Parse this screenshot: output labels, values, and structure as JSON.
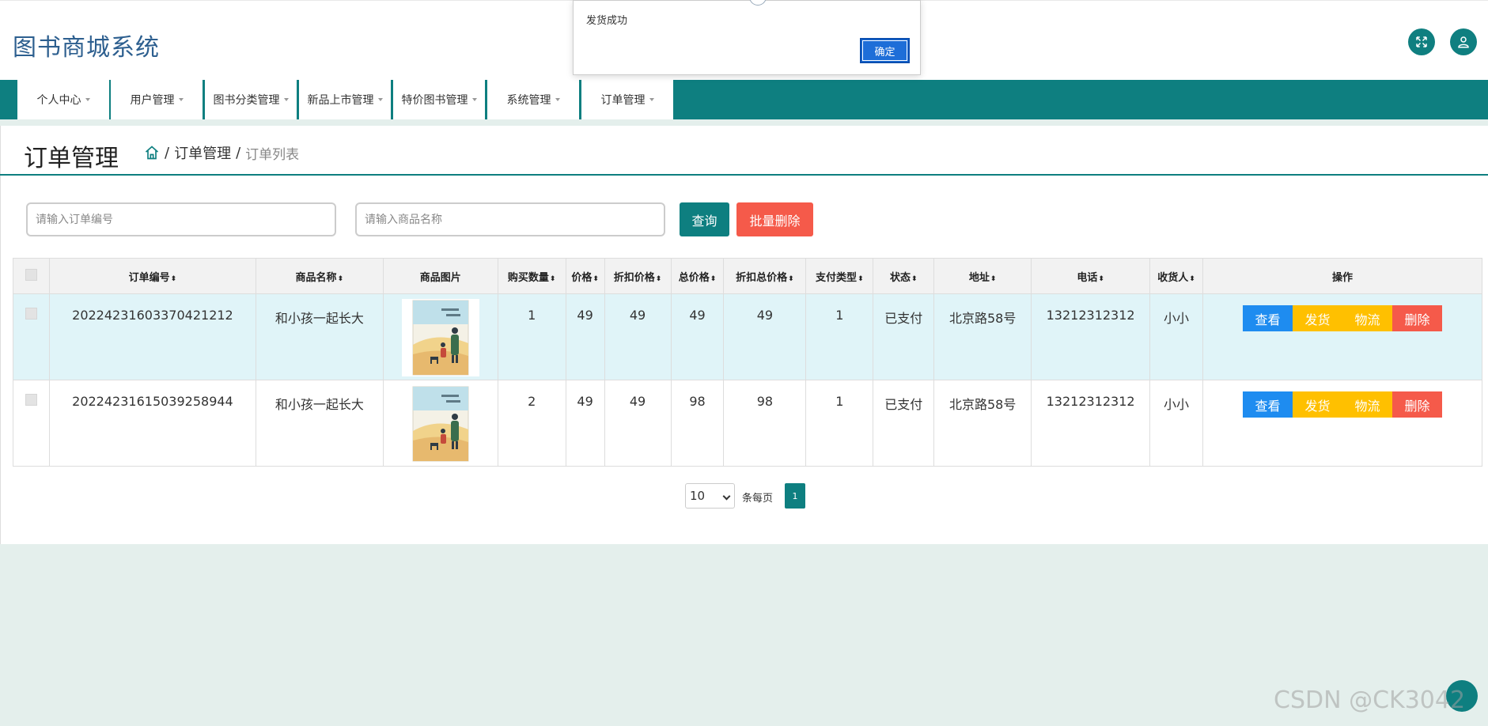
{
  "app": {
    "title": "图书商城系统"
  },
  "nav": {
    "items": [
      {
        "label": "个人中心"
      },
      {
        "label": "用户管理"
      },
      {
        "label": "图书分类管理"
      },
      {
        "label": "新品上市管理"
      },
      {
        "label": "特价图书管理"
      },
      {
        "label": "系统管理"
      },
      {
        "label": "订单管理"
      }
    ]
  },
  "page": {
    "title": "订单管理",
    "breadcrumb": {
      "sep": "/",
      "section": "订单管理",
      "current": "订单列表"
    }
  },
  "search": {
    "order_no_placeholder": "请输入订单编号",
    "product_placeholder": "请输入商品名称",
    "query_label": "查询",
    "batch_delete_label": "批量删除"
  },
  "table": {
    "headers": {
      "order_no": "订单编号",
      "product_name": "商品名称",
      "product_image": "商品图片",
      "quantity": "购买数量",
      "price": "价格",
      "discount_price": "折扣价格",
      "total": "总价格",
      "discount_total": "折扣总价格",
      "pay_type": "支付类型",
      "status": "状态",
      "address": "地址",
      "phone": "电话",
      "receiver": "收货人",
      "actions": "操作"
    },
    "actions": {
      "view": "查看",
      "ship": "发货",
      "logistics": "物流",
      "delete": "删除"
    },
    "rows": [
      {
        "order_no": "20224231603370421212",
        "product_name": "和小孩一起长大",
        "quantity": "1",
        "price": "49",
        "discount_price": "49",
        "total": "49",
        "discount_total": "49",
        "pay_type": "1",
        "status": "已支付",
        "address": "北京路58号",
        "phone": "13212312312",
        "receiver": "小小"
      },
      {
        "order_no": "20224231615039258944",
        "product_name": "和小孩一起长大",
        "quantity": "2",
        "price": "49",
        "discount_price": "49",
        "total": "98",
        "discount_total": "98",
        "pay_type": "1",
        "status": "已支付",
        "address": "北京路58号",
        "phone": "13212312312",
        "receiver": "小小"
      }
    ]
  },
  "pagination": {
    "page_size": "10",
    "per_page_label": "条每页",
    "current_page": "1"
  },
  "dialog": {
    "message": "发货成功",
    "ok_label": "确定"
  },
  "watermark": "CSDN @CK3042",
  "colors": {
    "primary": "#0e7f80",
    "danger": "#f55a4a",
    "info": "#1e8cf0",
    "warning": "#ffc000"
  }
}
